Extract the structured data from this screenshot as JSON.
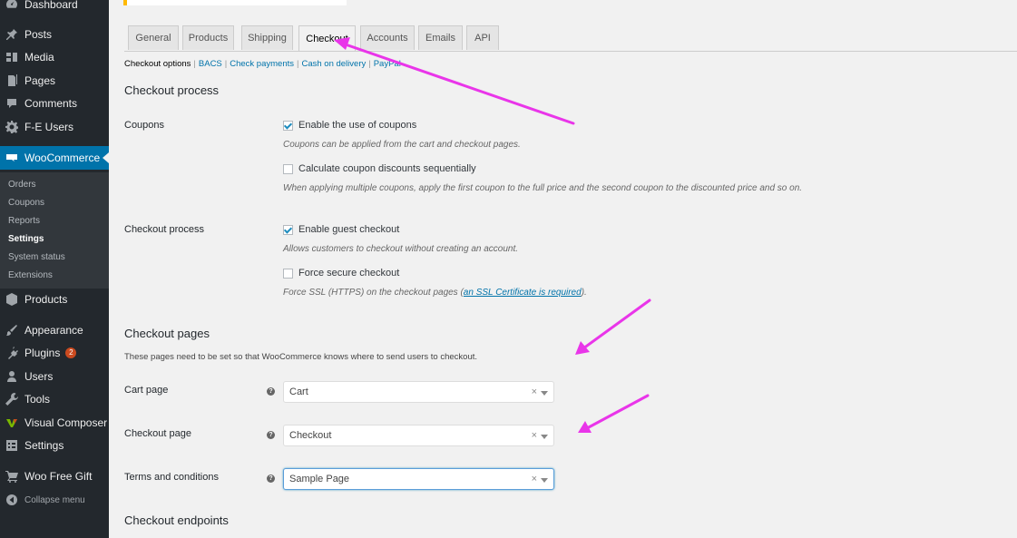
{
  "sidebar": {
    "items": [
      {
        "label": "Dashboard",
        "icon": "dashboard-icon"
      },
      {
        "label": "Posts",
        "icon": "pin-icon"
      },
      {
        "label": "Media",
        "icon": "media-icon"
      },
      {
        "label": "Pages",
        "icon": "page-icon"
      },
      {
        "label": "Comments",
        "icon": "comment-icon"
      },
      {
        "label": "F-E Users",
        "icon": "gear-icon"
      },
      {
        "label": "WooCommerce",
        "icon": "woo-icon"
      },
      {
        "label": "Products",
        "icon": "box-icon"
      },
      {
        "label": "Appearance",
        "icon": "brush-icon"
      },
      {
        "label": "Plugins",
        "icon": "plug-icon",
        "badge": "2"
      },
      {
        "label": "Users",
        "icon": "user-icon"
      },
      {
        "label": "Tools",
        "icon": "wrench-icon"
      },
      {
        "label": "Visual Composer",
        "icon": "vc-icon"
      },
      {
        "label": "Settings",
        "icon": "settings-icon"
      },
      {
        "label": "Woo Free Gift",
        "icon": "cart-icon"
      },
      {
        "label": "Collapse menu",
        "icon": "collapse-icon"
      }
    ],
    "submenu": [
      "Orders",
      "Coupons",
      "Reports",
      "Settings",
      "System status",
      "Extensions"
    ],
    "active_submenu": "Settings"
  },
  "tabs": [
    "General",
    "Products",
    "Shipping",
    "Checkout",
    "Accounts",
    "Emails",
    "API"
  ],
  "active_tab": "Checkout",
  "sections_nav": {
    "current": "Checkout options",
    "links": [
      "BACS",
      "Check payments",
      "Cash on delivery",
      "PayPal"
    ]
  },
  "checkout_process": {
    "heading": "Checkout process",
    "coupons_label": "Coupons",
    "enable_coupons": {
      "label": "Enable the use of coupons",
      "checked": true
    },
    "enable_coupons_desc": "Coupons can be applied from the cart and checkout pages.",
    "sequential": {
      "label": "Calculate coupon discounts sequentially",
      "checked": false
    },
    "sequential_desc": "When applying multiple coupons, apply the first coupon to the full price and the second coupon to the discounted price and so on.",
    "process_label": "Checkout process",
    "guest": {
      "label": "Enable guest checkout",
      "checked": true
    },
    "guest_desc": "Allows customers to checkout without creating an account.",
    "secure": {
      "label": "Force secure checkout",
      "checked": false
    },
    "secure_desc_before": "Force SSL (HTTPS) on the checkout pages (",
    "secure_desc_link": "an SSL Certificate is required",
    "secure_desc_after": ")."
  },
  "checkout_pages": {
    "heading": "Checkout pages",
    "description": "These pages need to be set so that WooCommerce knows where to send users to checkout.",
    "cart_label": "Cart page",
    "cart_value": "Cart",
    "checkout_label": "Checkout page",
    "checkout_value": "Checkout",
    "terms_label": "Terms and conditions",
    "terms_value": "Sample Page",
    "help_glyph": "?",
    "clear_glyph": "×"
  },
  "endpoints": {
    "heading": "Checkout endpoints"
  },
  "colors": {
    "annotation_arrow": "#e935e9",
    "accent": "#0073aa",
    "sidebar": "#23282d"
  }
}
